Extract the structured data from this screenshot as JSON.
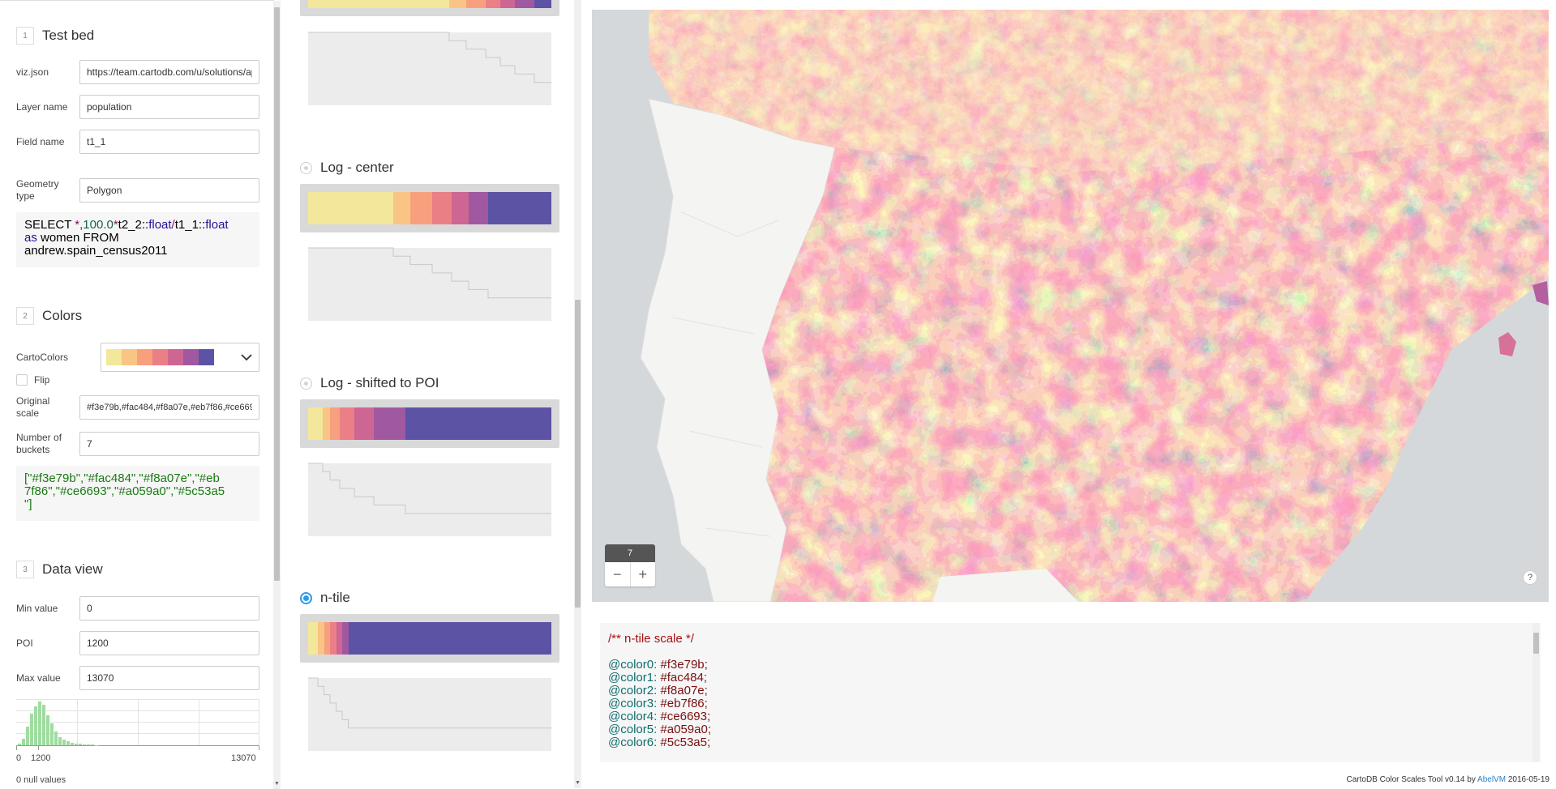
{
  "testbed": {
    "num": "1",
    "title": "Test bed",
    "vizjson_label": "viz.json",
    "vizjson_value": "https://team.cartodb.com/u/solutions/api/v2/viz/",
    "layer_label": "Layer name",
    "layer_value": "population",
    "field_label": "Field name",
    "field_value": "t1_1",
    "geom_label": "Geometry type",
    "geom_value": "Polygon",
    "sql": {
      "select": "SELECT ",
      "star": "*,",
      "n100": "100.0",
      "star2": "*",
      "t2": "t2_2::",
      "float1": "float",
      "slash": "/",
      "t1": "t1_1::",
      "float2": "float",
      "as": "as",
      "women_from": " women FROM",
      "table": "andrew.spain_census2011"
    }
  },
  "colors": {
    "num": "2",
    "title": "Colors",
    "cartocolors_label": "CartoColors",
    "palette": [
      "#f3e79b",
      "#fac484",
      "#f8a07e",
      "#eb7f86",
      "#ce6693",
      "#a059a0",
      "#5c53a5"
    ],
    "flip_label": "Flip",
    "orig_label": "Original scale",
    "orig_value": "#f3e79b,#fac484,#f8a07e,#eb7f86,#ce6693,#a059a0,#5c53a5",
    "buckets_label": "Number of buckets",
    "buckets_value": "7",
    "json_line1": "[\"#f3e79b\",\"#fac484\",\"#f8a07e\",\"#eb",
    "json_line2": "7f86\",\"#ce6693\",\"#a059a0\",\"#5c53a5",
    "json_line3": "\"]"
  },
  "dataview": {
    "num": "3",
    "title": "Data view",
    "min_label": "Min value",
    "min_value": "0",
    "poi_label": "POI",
    "poi_value": "1200",
    "max_label": "Max value",
    "max_value": "13070",
    "axis_min": "0",
    "axis_poi": "1200",
    "axis_max": "13070",
    "nulls": "0 null values",
    "histogram": [
      2,
      8,
      22,
      38,
      46,
      52,
      48,
      36,
      26,
      16,
      10,
      7,
      5,
      3,
      2,
      1.5,
      1,
      0.8,
      0.5,
      0.4
    ]
  },
  "options": [
    {
      "title": "Log - center",
      "selected": false,
      "ramp": [
        0.35,
        0.07,
        0.09,
        0.08,
        0.07,
        0.08,
        0.26
      ]
    },
    {
      "title": "Log - shifted to POI",
      "selected": false,
      "ramp": [
        0.06,
        0.03,
        0.04,
        0.06,
        0.08,
        0.13,
        0.6
      ]
    },
    {
      "title": "n-tile",
      "selected": true,
      "ramp": [
        0.04,
        0.025,
        0.025,
        0.025,
        0.025,
        0.025,
        0.835
      ]
    }
  ],
  "top_ramp": [
    0.58,
    0.07,
    0.08,
    0.06,
    0.06,
    0.08,
    0.07
  ],
  "map": {
    "zoom_level": "7",
    "zoom_out": "−",
    "zoom_in": "+",
    "help": "?"
  },
  "output": {
    "comment": "/** n-tile scale */",
    "vars": [
      {
        "name": "@color0:",
        "value": "#f3e79b;"
      },
      {
        "name": "@color1:",
        "value": "#fac484;"
      },
      {
        "name": "@color2:",
        "value": "#f8a07e;"
      },
      {
        "name": "@color3:",
        "value": "#eb7f86;"
      },
      {
        "name": "@color4:",
        "value": "#ce6693;"
      },
      {
        "name": "@color5:",
        "value": "#a059a0;"
      },
      {
        "name": "@color6:",
        "value": "#5c53a5;"
      }
    ]
  },
  "footer": {
    "text": "CartoDB Color Scales Tool v0.14 by ",
    "author": "AbelVM",
    "date": " 2016-05-19"
  }
}
